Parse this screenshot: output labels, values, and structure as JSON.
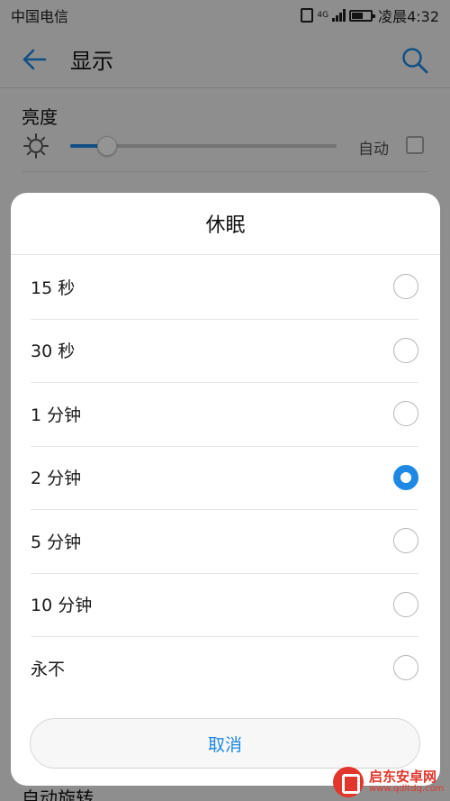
{
  "status_bar": {
    "carrier": "中国电信",
    "time": "凌晨4:32",
    "network": "4G"
  },
  "app_bar": {
    "title": "显示"
  },
  "brightness": {
    "label": "亮度",
    "level": 0.14,
    "auto_label": "自动",
    "auto_checked": false
  },
  "background_bottom_label": "自动旋转",
  "dialog": {
    "title": "休眠",
    "options": [
      {
        "label": "15 秒",
        "selected": false
      },
      {
        "label": "30 秒",
        "selected": false
      },
      {
        "label": "1 分钟",
        "selected": false
      },
      {
        "label": "2 分钟",
        "selected": true
      },
      {
        "label": "5 分钟",
        "selected": false
      },
      {
        "label": "10 分钟",
        "selected": false
      },
      {
        "label": "永不",
        "selected": false
      }
    ],
    "cancel_label": "取消"
  },
  "watermark": {
    "name": "启东安卓网",
    "url": "www.qdltdq.com"
  },
  "colors": {
    "accent": "#1e88e5",
    "watermark": "#e2352b"
  }
}
